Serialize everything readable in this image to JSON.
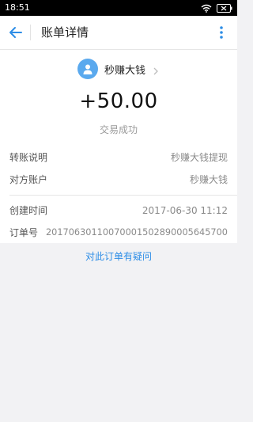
{
  "status_bar": {
    "time": "18:51",
    "icons": [
      "wifi-icon",
      "battery-icon"
    ]
  },
  "app_bar": {
    "title": "账单详情",
    "back_icon": "back-arrow-icon",
    "more_icon": "more-vertical-icon"
  },
  "payee": {
    "name": "秒赚大钱",
    "avatar_icon": "user-avatar-icon"
  },
  "transaction": {
    "amount": "+50.00",
    "status": "交易成功"
  },
  "details": [
    {
      "label": "转账说明",
      "value": "秒赚大钱提现"
    },
    {
      "label": "对方账户",
      "value": "秒赚大钱"
    },
    {
      "label": "创建时间",
      "value": "2017-06-30 11:12"
    },
    {
      "label": "订单号",
      "value": "20170630110070001502890005645700"
    }
  ],
  "footer": {
    "question_link": "对此订单有疑问"
  },
  "colors": {
    "accent": "#2d8de6",
    "avatar_bg": "#5aa9ee",
    "page_bg": "#f2f2f4"
  }
}
